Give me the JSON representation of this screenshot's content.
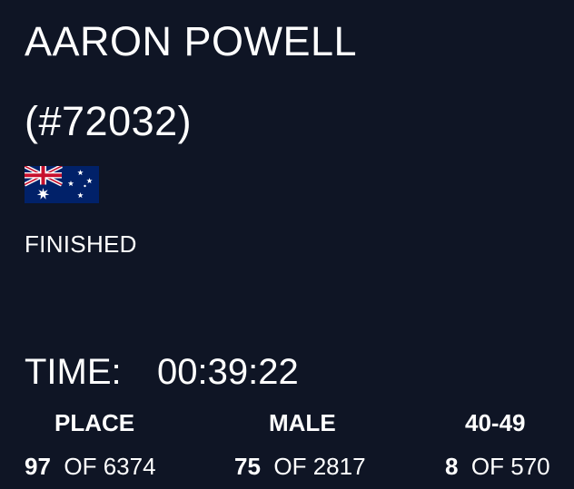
{
  "athlete": {
    "name": "AARON POWELL",
    "bib": "(#72032)",
    "flag_icon": "australia-flag-icon",
    "status": "FINISHED"
  },
  "result": {
    "time_label": "TIME:",
    "time_value": "00:39:22"
  },
  "rankings": {
    "overall": {
      "header": "PLACE",
      "position": "97",
      "of_label": "OF",
      "total": "6374"
    },
    "gender": {
      "header": "MALE",
      "position": "75",
      "of_label": "OF",
      "total": "2817"
    },
    "age_group": {
      "header": "40-49",
      "position": "8",
      "of_label": "OF",
      "total": "570"
    }
  },
  "colors": {
    "background": "#0f1525",
    "text": "#ffffff",
    "flag_blue": "#012169",
    "flag_red": "#c8102e"
  }
}
